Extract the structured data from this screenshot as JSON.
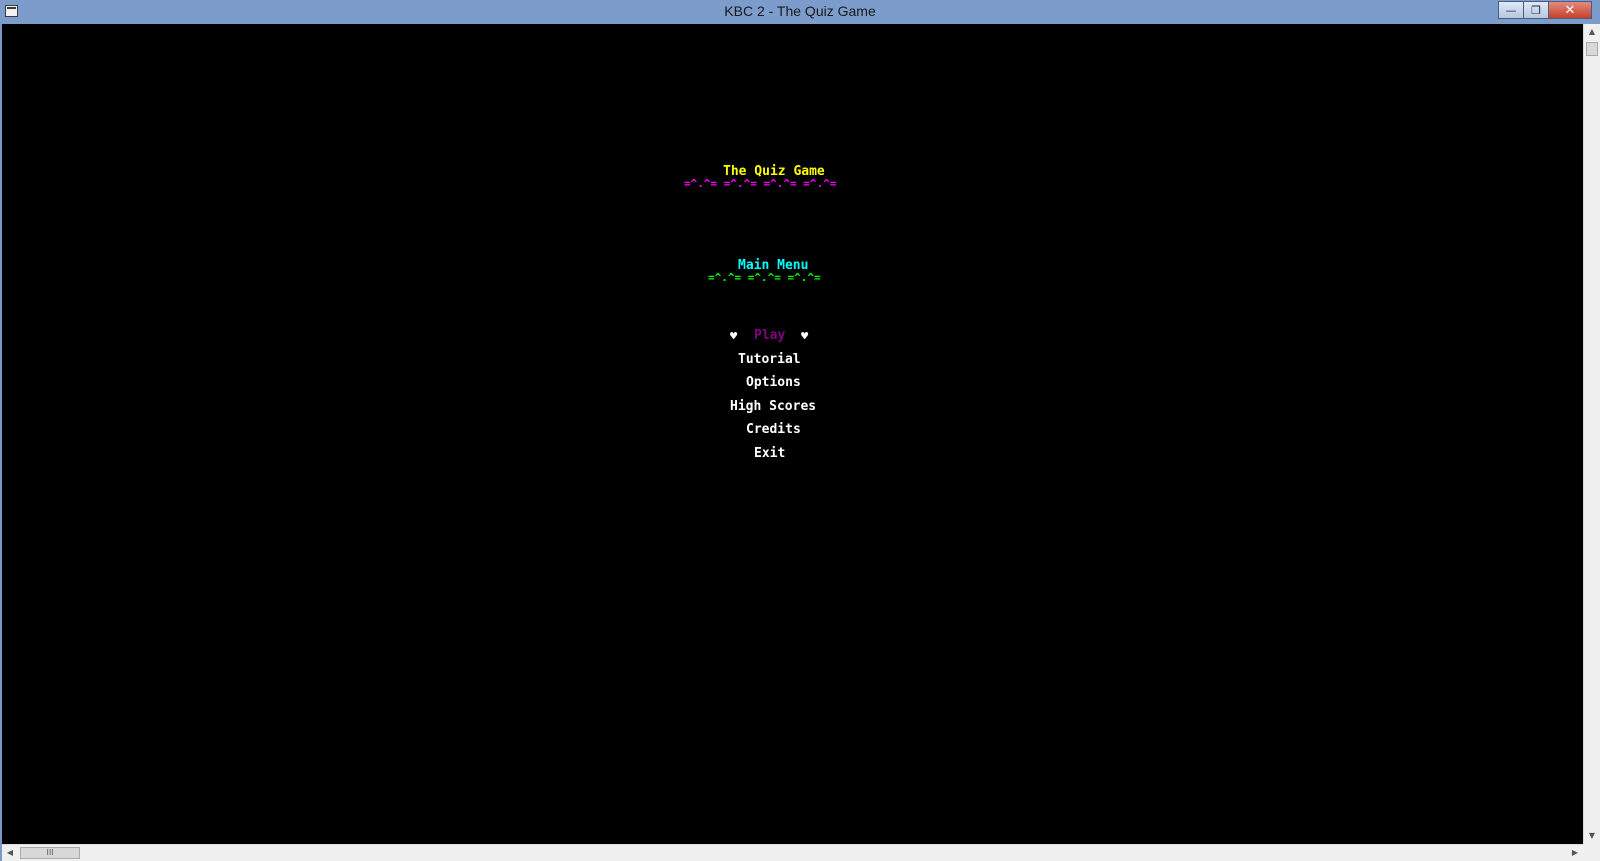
{
  "window": {
    "title": "KBC 2 - The Quiz Game",
    "controls": {
      "minimize": "—",
      "restore": "❐",
      "close": "✕"
    }
  },
  "screen": {
    "game_title": "The Quiz Game",
    "title_decoration": "=^.^= =^.^= =^.^= =^.^=",
    "menu_heading": "Main Menu",
    "menu_decoration": "=^.^= =^.^= =^.^=",
    "selector_glyph": "♥",
    "menu_items": [
      "Play",
      "Tutorial",
      "Options",
      "High Scores",
      "Credits",
      "Exit"
    ],
    "selected_item": "Play"
  },
  "scrollbars": {
    "vertical_thumb_glyph": "",
    "horizontal_thumb_glyph": "III"
  },
  "colors": {
    "title": "#ffff00",
    "title_decoration": "#ff00ff",
    "heading": "#00ffff",
    "heading_decoration": "#00ff00",
    "selected": "#800080",
    "menu_text": "#ffffff",
    "selector": "#ffffff",
    "console_bg": "#000000"
  }
}
